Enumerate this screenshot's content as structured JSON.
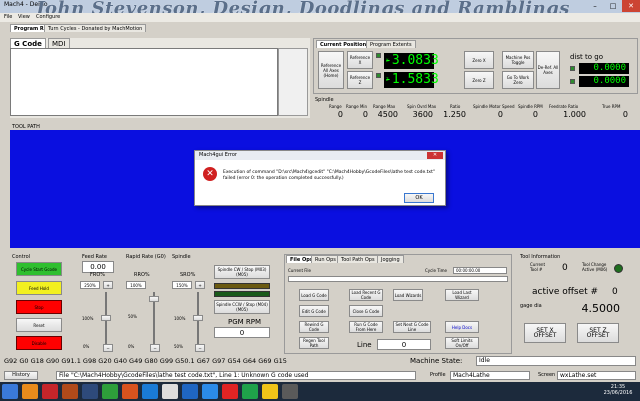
{
  "window": {
    "title": "Mach4 - Demo",
    "watermark": "John Stevenson, Design, Doodlings and Ramblings"
  },
  "menu": [
    "File",
    "View",
    "Configure",
    "Operator",
    "Wizard",
    "Diagnostic",
    "Help"
  ],
  "program_tabs": [
    "Program Run",
    "Turn Cycles - Donated by MachMotion"
  ],
  "code_tabs": [
    "G Code",
    "MDI"
  ],
  "positions": {
    "tabs": [
      "Current Positions",
      "Program Extents"
    ],
    "ref_all": "Reference All Axes (Home)",
    "ref_x": "Reference X",
    "ref_z": "Reference Z",
    "x_label": "X",
    "z_label": "Z",
    "x_value": "-3.0833",
    "z_value": "-1.5833",
    "zero_x": "Zero X",
    "zero_z": "Zero Z",
    "machine_toggle": "Machine Pos Toggle",
    "goto_work": "Go To Work Zero",
    "deref": "De-Ref. All Axes",
    "dist_to_go": "dist to go",
    "dtg_x": "0.0000",
    "dtg_z": "0.0000"
  },
  "spindle_row": {
    "title": "Spindle",
    "labels": [
      "Range",
      "Range Min",
      "Range Max",
      "Spin Ovrd Max",
      "Ratio",
      "Spindle Motor Speed",
      "Spindle RPM",
      "Feedrate Ratio",
      "True RPM"
    ],
    "values": [
      "0",
      "0",
      "4500",
      "3600",
      "1.250",
      "0",
      "0",
      "1.000",
      "0"
    ]
  },
  "toolpath_label": "TOOL PATH",
  "dialog": {
    "title": "Mach4gui Error",
    "message": "Execution of command \"D:\\src\\Mach4\\gcedit\" \"C:\\Mach4Hobby\\GcodeFiles\\lathe test code.txt\" failed (error 0: the operation completed successfully.)",
    "ok": "OK"
  },
  "control": {
    "title": "Control",
    "cycle_start": "Cycle Start Gcode",
    "feed_hold": "Feed Hold",
    "stop": "Stop",
    "reset": "Reset",
    "disable": "Disable"
  },
  "feed": {
    "title": "Feed Rate",
    "value": "0.00",
    "fro_label": "FRO%",
    "fro": "250%",
    "pct": "100%",
    "zero": "0%"
  },
  "rapid": {
    "title": "Rapid Rate (G0)",
    "rro_label": "RRO%",
    "rro": "100%",
    "pct": "50%",
    "zero": "0%"
  },
  "spindle": {
    "title": "Spindle",
    "sro_label": "SRO%",
    "sro": "150%",
    "pct": "100%",
    "zero": "50%",
    "cw": "Spindle CW / Stop (M03) (M05)",
    "ccw": "Spindle CCW / Stop (M04) (M05)",
    "pgm_rpm": "PGM RPM",
    "rpm": "0"
  },
  "file_tabs": [
    "File Ops",
    "Run Ops",
    "Tool Path Ops",
    "Jogging"
  ],
  "file": {
    "current_file": "Current File",
    "cycle_time_label": "Cycle Time",
    "cycle_time": "00:00:00.00",
    "buttons": [
      "Load G Code",
      "Load Recent G Code",
      "Load Wizards",
      "Load Last Wizard",
      "Edit G Code",
      "Close G Code",
      "Rewind G Code",
      "Run G Code From Here",
      "Set Next G Code Line",
      "Help Docs",
      "Regen Tool Path",
      "Soft Limits On/Off"
    ],
    "line_label": "Line",
    "line": "0"
  },
  "tool": {
    "title": "Tool Information",
    "current_label": "Current Tool #",
    "current": "0",
    "change_label": "Tool Change Active (M06)",
    "offset_label": "active offset #",
    "offset": "0",
    "gage_label": "gage dia",
    "gage": "4.5000",
    "setx": "SET X OFFSET",
    "setz": "SET Z OFFSET"
  },
  "gcodes": "G92 G0 G18 G90 G91.1 G98 G20 G40 G49 G80 G99 G50.1 G67 G97 G54 G64 G69 G15",
  "machine_state_label": "Machine State:",
  "machine_state": "Idle",
  "status": {
    "history": "History",
    "message": "File \"C:\\Mach4Hobby\\GcodeFiles\\lathe test code.txt\", Line 1: Unknown G code used",
    "profile_label": "Profile",
    "profile": "Mach4Lathe",
    "screen_label": "Screen",
    "screen": "wxLathe.set"
  },
  "clock": {
    "time": "21:35",
    "date": "23/06/2016"
  }
}
